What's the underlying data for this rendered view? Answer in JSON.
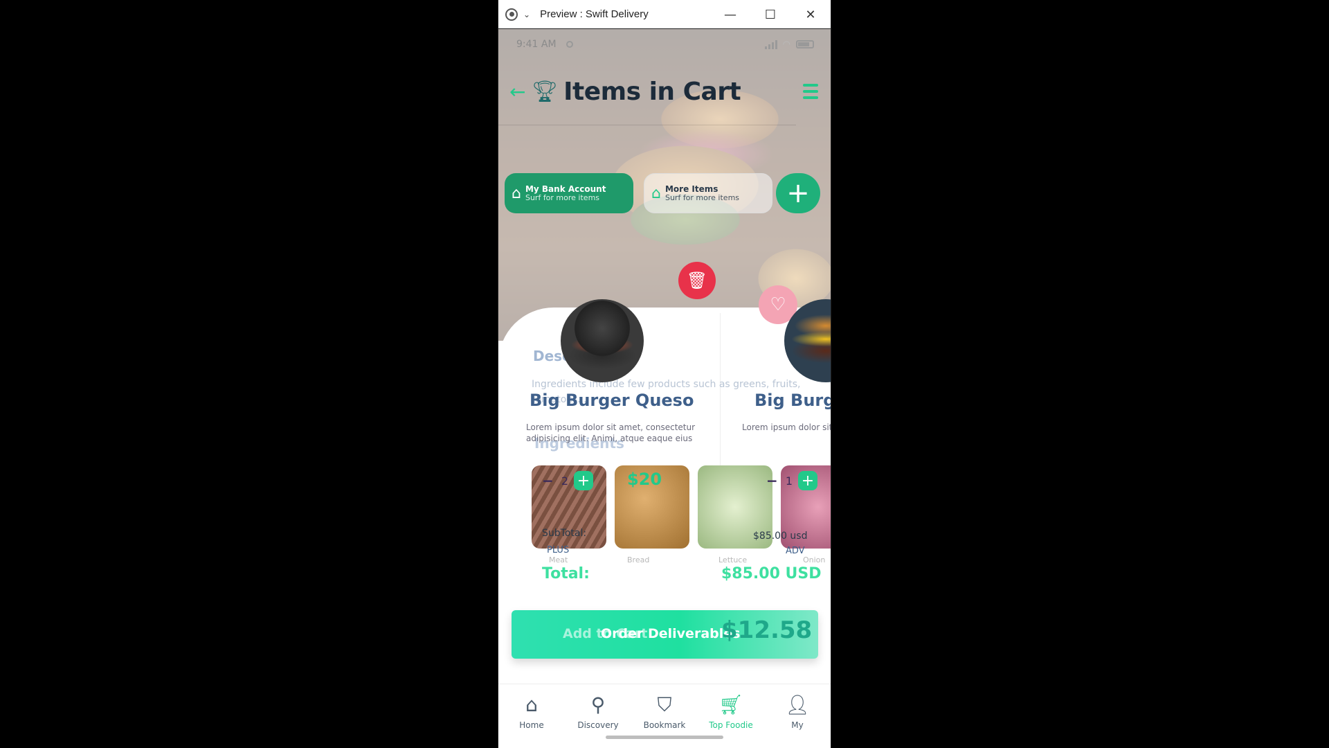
{
  "window": {
    "title": "Preview : Swift Delivery",
    "minimize_icon": "—",
    "maximize_icon": "☐",
    "close_icon": "✕"
  },
  "status": {
    "time": "9:41 AM"
  },
  "header": {
    "title": "Items in Cart",
    "back_icon": "arrow-left-icon",
    "menu_icon": "list-menu-icon"
  },
  "pills": {
    "bank": {
      "title": "My Bank Account",
      "subtitle": "Surf for more items"
    },
    "more": {
      "title": "More Items",
      "subtitle": "Surf for more items"
    },
    "add": "+"
  },
  "description": {
    "title": "Description",
    "text": "Ingredients include few products such as greens, fruits, tomatoes...",
    "ingredients_title": "Ingredients"
  },
  "products": [
    {
      "name": "Big Burger Queso",
      "text": "Lorem ipsum dolor sit amet, consectetur adipisicing elit. Animi, atque eaque eius",
      "qty": "2",
      "subtotal_label": "SubTotal:",
      "tag": "PLUS"
    },
    {
      "name": "Big Burger",
      "text": "Lorem ipsum dolor sit amet, consectetur adipisicing elit. Animi, atque eaque eius",
      "qty": "1",
      "subtotal_value": "$85.00 usd",
      "tag": "ADV"
    }
  ],
  "ingredients": [
    {
      "label": "Meat"
    },
    {
      "label": "Bread",
      "price": "$20"
    },
    {
      "label": "Lettuce"
    },
    {
      "label": "Onion"
    }
  ],
  "total": {
    "label": "Total:",
    "value": "$85.00 USD"
  },
  "order": {
    "ghost_label": "Add to Cart",
    "label": "Order Deliverables",
    "price": "$12.58"
  },
  "nav": [
    {
      "label": "Home",
      "icon": "home-icon"
    },
    {
      "label": "Discovery",
      "icon": "map-pin-icon"
    },
    {
      "label": "Bookmark",
      "icon": "bookmark-icon"
    },
    {
      "label": "Top Foodie",
      "icon": "cart-icon",
      "active": true
    },
    {
      "label": "My",
      "icon": "user-icon"
    }
  ],
  "colors": {
    "accent": "#22c98a",
    "danger": "#e8324a",
    "title": "#1c2b3a",
    "product": "#3e5f8a"
  }
}
